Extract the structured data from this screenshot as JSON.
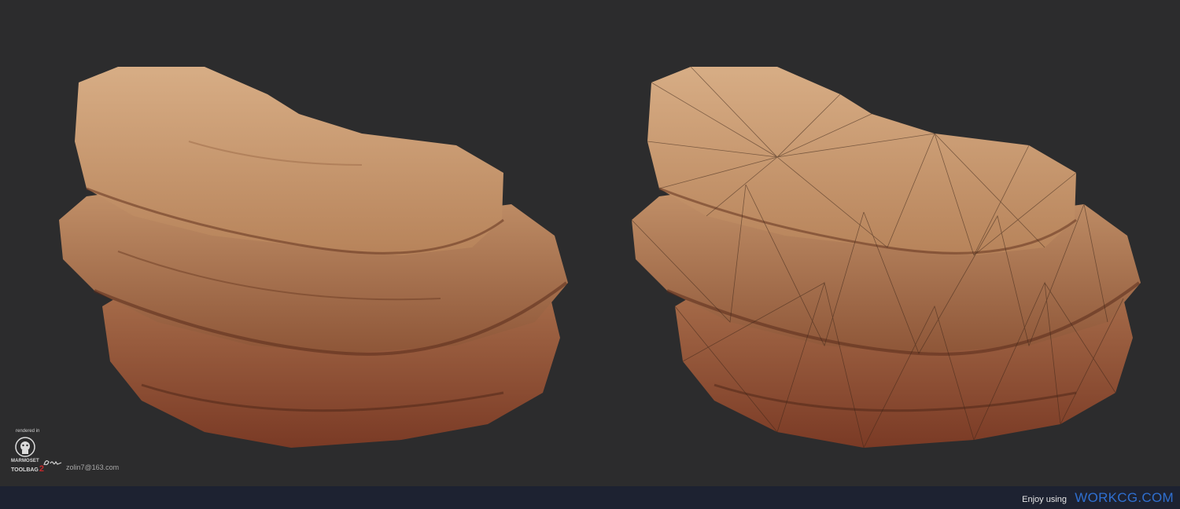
{
  "badge": {
    "rendered_in": "rendered in",
    "brand_line1": "MARMOSET",
    "brand_line2": "TOOLBAG",
    "brand_version": "2",
    "email": "zolin7@163.com"
  },
  "footer": {
    "enjoy_text": "Enjoy using",
    "site_text": "WORKCG.COM"
  },
  "images": [
    {
      "name": "rock-render-textured",
      "wireframe": false
    },
    {
      "name": "rock-render-wireframe",
      "wireframe": true
    }
  ],
  "colors": {
    "background": "#2c2c2d",
    "rock_light": "#c99a6f",
    "rock_mid": "#a8704a",
    "rock_dark": "#6e3a24",
    "footer_bg": "#1d2231",
    "site_link": "#2f6fd0",
    "brand_accent": "#c8282b"
  }
}
